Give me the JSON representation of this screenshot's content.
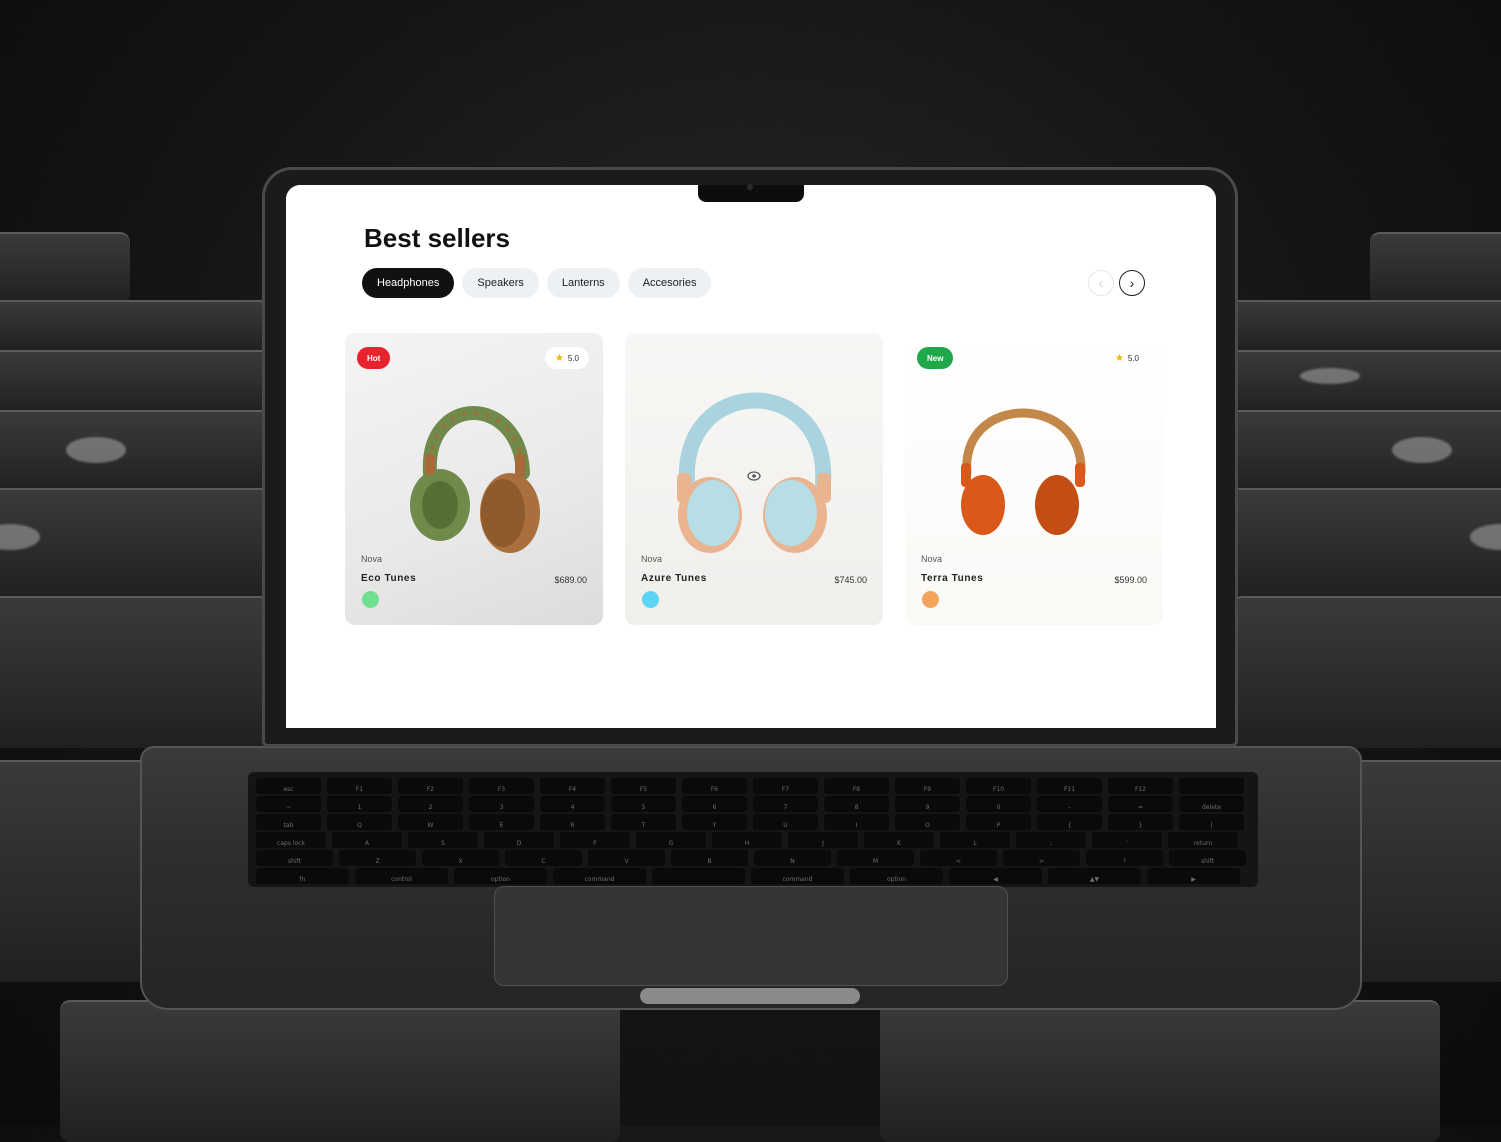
{
  "page": {
    "title": "Best sellers"
  },
  "tabs": [
    {
      "label": "Headphones",
      "active": true
    },
    {
      "label": "Speakers",
      "active": false
    },
    {
      "label": "Lanterns",
      "active": false
    },
    {
      "label": "Accesories",
      "active": false
    }
  ],
  "nav": {
    "prev_icon": "chevron-left-icon",
    "next_icon": "chevron-right-icon"
  },
  "products": [
    {
      "badge": "Hot",
      "badge_color": "#e8232d",
      "rating": "5.0",
      "brand": "Nova",
      "name": "Eco Tunes",
      "price": "$689.00",
      "color": "#6ee08f",
      "headphone_color": "#6f8a4a"
    },
    {
      "badge": "",
      "badge_color": "",
      "rating": "",
      "brand": "Nova",
      "name": "Azure Tunes",
      "price": "$745.00",
      "color": "#5bd4f5",
      "headphone_color": "#a9d3de"
    },
    {
      "badge": "New",
      "badge_color": "#1fa84a",
      "rating": "5.0",
      "brand": "Nova",
      "name": "Terra Tunes",
      "price": "$599.00",
      "color": "#f4a45b",
      "headphone_color": "#d9581a"
    }
  ],
  "keyboard": {
    "rows": [
      [
        "esc",
        "F1",
        "F2",
        "F3",
        "F4",
        "F5",
        "F6",
        "F7",
        "F8",
        "F9",
        "F10",
        "F11",
        "F12",
        ""
      ],
      [
        "~",
        "1",
        "2",
        "3",
        "4",
        "5",
        "6",
        "7",
        "8",
        "9",
        "0",
        "-",
        "=",
        "delete"
      ],
      [
        "tab",
        "Q",
        "W",
        "E",
        "R",
        "T",
        "Y",
        "U",
        "I",
        "O",
        "P",
        "{",
        "}",
        "|"
      ],
      [
        "caps lock",
        "A",
        "S",
        "D",
        "F",
        "G",
        "H",
        "J",
        "K",
        "L",
        ";",
        "'",
        "return"
      ],
      [
        "shift",
        "Z",
        "X",
        "C",
        "V",
        "B",
        "N",
        "M",
        "<",
        ">",
        "?",
        "shift"
      ],
      [
        "fn",
        "control",
        "option",
        "command",
        "",
        "command",
        "option",
        "◀",
        "▲▼",
        "▶"
      ]
    ]
  }
}
